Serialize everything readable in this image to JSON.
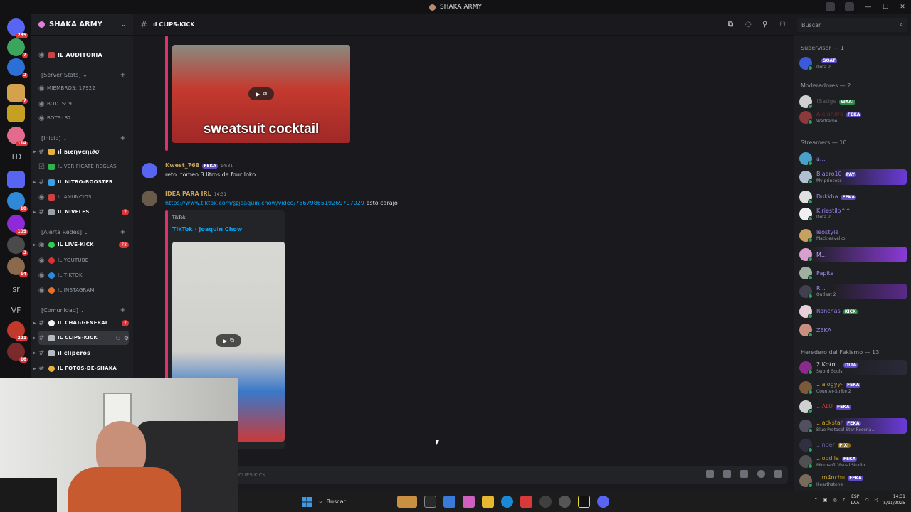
{
  "window": {
    "title": "SHAKA ARMY",
    "controls": [
      "—",
      "☐",
      "✕"
    ]
  },
  "rail": {
    "servers": [
      {
        "top": 0,
        "color": "#5865f2",
        "badge": "285"
      },
      {
        "color": "#3ba55c",
        "badge": "7"
      },
      {
        "color": "#2c6fd6",
        "badge": "2"
      },
      {
        "color": "#d3a24a",
        "badge": "7"
      },
      {
        "color": "#c6a020",
        "badge": ""
      },
      {
        "color": "#e46b8e",
        "badge": "114"
      },
      {
        "text": "TD"
      },
      {
        "color": "#5865f2",
        "badge": ""
      },
      {
        "color": "#2e8ad8",
        "badge": "10"
      },
      {
        "color": "#8f2ad8",
        "badge": "109"
      },
      {
        "color": "#4a4a4a",
        "badge": "3"
      },
      {
        "color": "#8a6a4a",
        "badge": "14"
      },
      {
        "text": "sr"
      },
      {
        "text": "VF"
      },
      {
        "color": "#c0392b",
        "badge": "221"
      },
      {
        "color": "#7a2a2a",
        "badge": "16"
      }
    ]
  },
  "guild": {
    "name": "SHAKA ARMY"
  },
  "channels": {
    "auditoria": "ıl AUDITORIA",
    "cat_stats": "[Server Stats]",
    "miembros": "MIEMBROS: 17922",
    "boots": "BOOTS: 9",
    "bots": "BOTS: 32",
    "cat_inicio": "[Inicio]",
    "bienvenido": "ıl вιєηνєηι∂σ",
    "verificate": "ıl VERIFICATE-REGLAS",
    "nitro": "ıl NITRO-BOOSTER",
    "anuncios": "ıl ANUNCIOS",
    "niveles": "ıl NIVELES",
    "niveles_badge": "2",
    "cat_alerta": "[Alerta Redes]",
    "livekick": "ıl LIVE-KICK",
    "livekick_badge": "73",
    "youtube": "ıl YOUTUBE",
    "tiktok": "ıl TIKTOK",
    "instagram": "ıl INSTAGRAM",
    "cat_comunidad": "[Comunidad]",
    "chatgeneral": "ıl CHAT-GENERAL",
    "chatgeneral_badge": "7",
    "clipskick": "ıl CLIPS-KICK",
    "cliperos": "ıl cliperos",
    "fotos": "ıl FOTOS-DE-SHAKA"
  },
  "header": {
    "channel": "ıl CLIPS-KICK"
  },
  "search": {
    "placeholder": "Buscar"
  },
  "messages": {
    "embed1_caption": "sweatsuit cocktail",
    "m1_user": "Kwest_768",
    "m1_tag": "FEKA",
    "m1_time": "14:31",
    "m1_text": "reto: tomen 3 litros de four loko",
    "m2_user": "IDEA PARA IRL",
    "m2_time": "14:31",
    "m2_link": "https://www.tiktok.com/@joaquin.chow/video/7567986519269707029",
    "m2_text": " esto carajo",
    "embed2_provider": "TikTok",
    "embed2_title": "TikTok · Joaquin Chow"
  },
  "composer": {
    "placeholder": "CLIPS-KICK"
  },
  "members": {
    "g_supervisor": "Supervisor — 1",
    "sup1_tag": "GOAT",
    "sup1_act": "Dota 2",
    "g_mods": "Moderadores — 2",
    "mod1": "!Sadge",
    "mod1_tag": "WAA!",
    "mod2": "Alejandro",
    "mod2_tag": "FEKA",
    "mod2_act": "Warframe",
    "g_streamers": "Streamers — 10",
    "s1": "a...",
    "s2": "Blaero10",
    "s2_tag": "PAY",
    "s2_act": "My princess",
    "s3": "Dukkha",
    "s3_tag": "FEKA",
    "s4": "Kiriestilo^^",
    "s4_act": "Dota 2",
    "s5": "leostyle",
    "s5_act": "Mackieavelko",
    "s6": "M...",
    "s7": "Papita",
    "s8": "R...",
    "s8_act": "Outlast 2",
    "s9": "Ronchas",
    "s9_tag": "KICK",
    "s10": "ZEKA",
    "g_herederos": "Heredero del Fekismo — 13",
    "h1": "2 Kαℓσ...",
    "h1_tag": "DLTA",
    "h1_act": "Sword Souls",
    "h2": "...alogyy-",
    "h2_tag": "FEKA",
    "h2_act": "Counter-Strike 2",
    "h3": "...ALU",
    "h3_tag": "FEKA",
    "h4": "...ackstar",
    "h4_tag": "FEKA",
    "h4_act": "Blue Protocol Star Resona...",
    "h5": "...nder",
    "h5_tag": "PIXI",
    "h6": "...oodila",
    "h6_tag": "FEKA",
    "h6_act": "Microsoft Visual Studio",
    "h7": "...m4nchu",
    "h7_tag": "FEKA",
    "h7_act": "Hearthstone"
  },
  "taskbar": {
    "search": "Buscar",
    "lang1": "ESP",
    "lang2": "LAA",
    "time": "14:31",
    "date": "5/11/2025"
  }
}
